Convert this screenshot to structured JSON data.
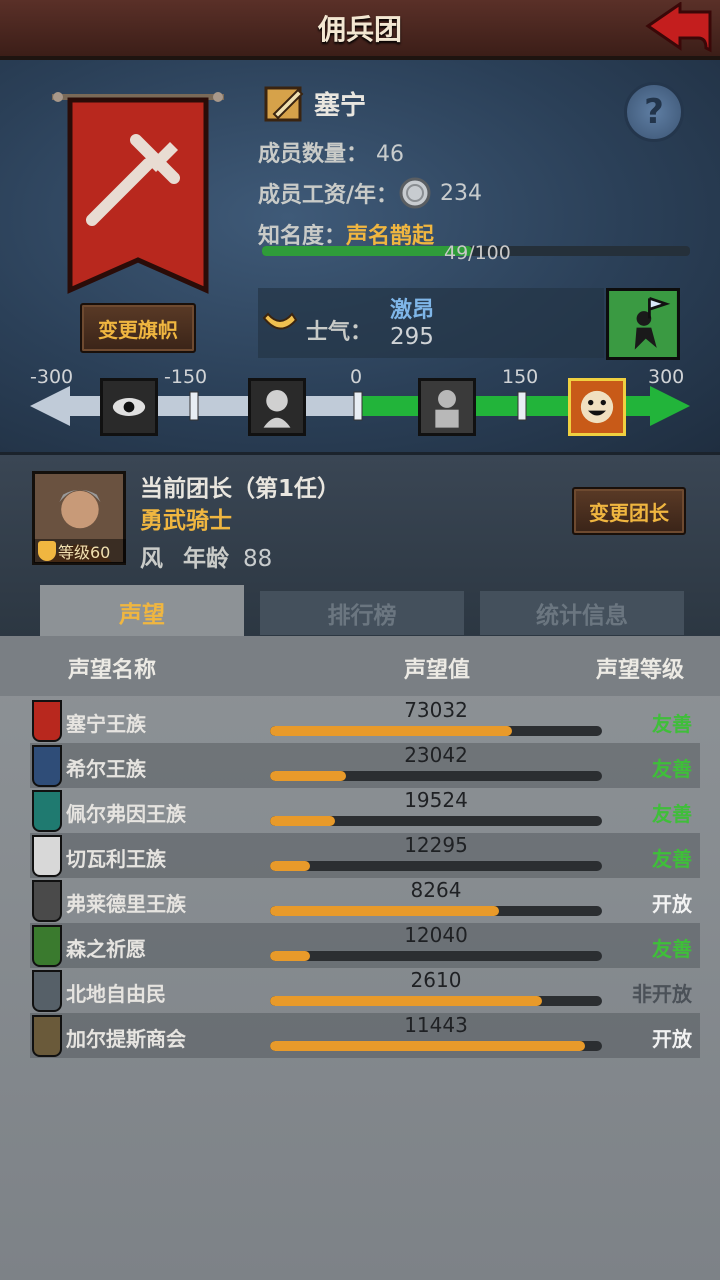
{
  "header": {
    "title": "佣兵团"
  },
  "guild": {
    "name": "塞宁",
    "members_label": "成员数量：",
    "members_value": "46",
    "wage_label": "成员工资/年：",
    "wage_value": "234",
    "fame_label": "知名度：",
    "fame_value": "声名鹊起",
    "fame_progress_text": "49/100",
    "fame_progress": 0.49,
    "change_flag_label": "变更旗帜",
    "help_label": "?"
  },
  "morale": {
    "label": "士气：",
    "word": "激昂",
    "value": "295",
    "ticks": [
      "-300",
      "-150",
      "0",
      "150",
      "300"
    ]
  },
  "leader": {
    "title": "当前团长（第1任）",
    "class": "勇武骑士",
    "element": "风",
    "age_label": "年龄",
    "age_value": "88",
    "level_text": "等级60",
    "change_label": "变更团长"
  },
  "tabs": [
    "声望",
    "排行榜",
    "统计信息"
  ],
  "table": {
    "headers": [
      "声望名称",
      "声望值",
      "声望等级"
    ],
    "rows": [
      {
        "name": "塞宁王族",
        "value": "73032",
        "level": "友善",
        "progress": 0.73,
        "icon": "red-cross-crest-icon",
        "icon_color": "#b8281e",
        "level_color": "#3fbe3a"
      },
      {
        "name": "希尔王族",
        "value": "23042",
        "level": "友善",
        "progress": 0.23,
        "icon": "blue-helm-crest-icon",
        "icon_color": "#2f4d78",
        "level_color": "#3fbe3a"
      },
      {
        "name": "佩尔弗因王族",
        "value": "19524",
        "level": "友善",
        "progress": 0.195,
        "icon": "teal-moon-crest-icon",
        "icon_color": "#1f7a70",
        "level_color": "#3fbe3a"
      },
      {
        "name": "切瓦利王族",
        "value": "12295",
        "level": "友善",
        "progress": 0.12,
        "icon": "white-scale-crest-icon",
        "icon_color": "#d8d8d8",
        "level_color": "#3fbe3a"
      },
      {
        "name": "弗莱德里王族",
        "value": "8264",
        "level": "开放",
        "progress": 0.69,
        "icon": "grey-wolf-crest-icon",
        "icon_color": "#4a4a4a",
        "level_color": "#f2f2f2"
      },
      {
        "name": "森之祈愿",
        "value": "12040",
        "level": "友善",
        "progress": 0.12,
        "icon": "green-tree-crest-icon",
        "icon_color": "#3a7a2e",
        "level_color": "#3fbe3a"
      },
      {
        "name": "北地自由民",
        "value": "2610",
        "level": "非开放",
        "progress": 0.82,
        "icon": "grey-axes-crest-icon",
        "icon_color": "#566068",
        "level_color": "#4b5158"
      },
      {
        "name": "加尔提斯商会",
        "value": "11443",
        "level": "开放",
        "progress": 0.95,
        "icon": "chest-crest-icon",
        "icon_color": "#6a5a3a",
        "level_color": "#f2f2f2"
      }
    ]
  }
}
